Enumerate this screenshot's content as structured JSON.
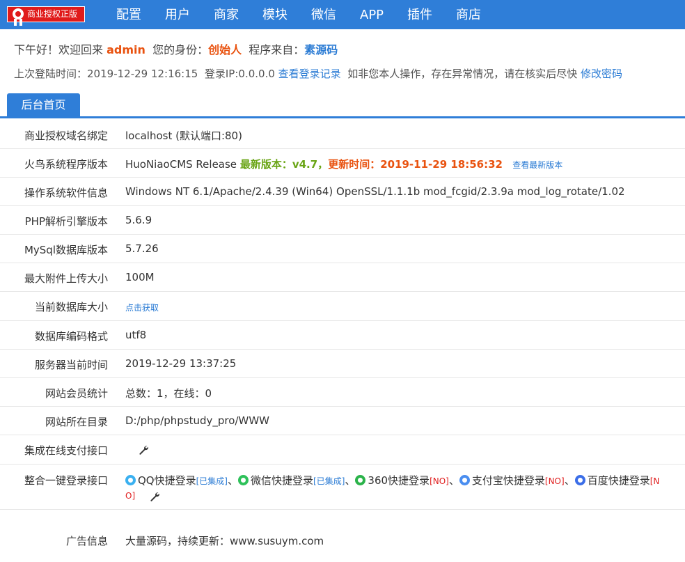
{
  "topbar": {
    "badge_label": "商业授权正版",
    "nav": [
      "配置",
      "用户",
      "商家",
      "模块",
      "微信",
      "APP",
      "插件",
      "商店"
    ]
  },
  "welcome": {
    "greeting": "下午好！欢迎回来",
    "username": "admin",
    "role_label": "您的身份：",
    "role": "创始人",
    "source_label": "程序来自：",
    "source": "素源码"
  },
  "last_login": {
    "time_label": "上次登陆时间：",
    "time": "2019-12-29 12:16:15",
    "ip_label": "登录IP:",
    "ip": "0.0.0.0",
    "records_link": "查看登录记录",
    "warning": "如非您本人操作，存在异常情况，请在核实后尽快",
    "change_password_link": "修改密码"
  },
  "tab": {
    "label": "后台首页"
  },
  "rows": {
    "domain": {
      "label": "商业授权域名绑定",
      "value": "localhost (默认端口:80)"
    },
    "version": {
      "label": "火鸟系统程序版本",
      "value": "HuoNiaoCMS Release",
      "latest": "最新版本：v4.7，",
      "update_time": "更新时间：2019-11-29 18:56:32",
      "check_link": "查看最新版本"
    },
    "os": {
      "label": "操作系统软件信息",
      "value": "Windows NT 6.1/Apache/2.4.39 (Win64) OpenSSL/1.1.1b mod_fcgid/2.3.9a mod_log_rotate/1.02"
    },
    "php": {
      "label": "PHP解析引擎版本",
      "value": "5.6.9"
    },
    "mysql": {
      "label": "MySql数据库版本",
      "value": "5.7.26"
    },
    "upload": {
      "label": "最大附件上传大小",
      "value": "100M"
    },
    "dbsize": {
      "label": "当前数据库大小",
      "value": "点击获取"
    },
    "encoding": {
      "label": "数据库编码格式",
      "value": "utf8"
    },
    "server_time": {
      "label": "服务器当前时间",
      "value": "2019-12-29 13:37:25"
    },
    "members": {
      "label": "网站会员统计",
      "value": "总数：1，在线：0"
    },
    "directory": {
      "label": "网站所在目录",
      "value": "D:/php/phpstudy_pro/WWW"
    },
    "payment": {
      "label": "集成在线支付接口"
    },
    "login": {
      "label": "整合一键登录接口",
      "sep": "、",
      "items": [
        {
          "name": "QQ快捷登录",
          "status": "[已集成]",
          "color": "#3ab0f0"
        },
        {
          "name": "微信快捷登录",
          "status": "[已集成]",
          "color": "#2ec15a"
        },
        {
          "name": "360快捷登录",
          "status": "[NO]",
          "color": "#2bb34a"
        },
        {
          "name": "支付宝快捷登录",
          "status": "[NO]",
          "color": "#4a8ef0"
        },
        {
          "name": "百度快捷登录",
          "status": "[N",
          "color": "#3b6ee8"
        }
      ],
      "overflow": "O]"
    },
    "ads": {
      "label": "广告信息",
      "value": "大量源码，持续更新：www.susuym.com"
    }
  }
}
